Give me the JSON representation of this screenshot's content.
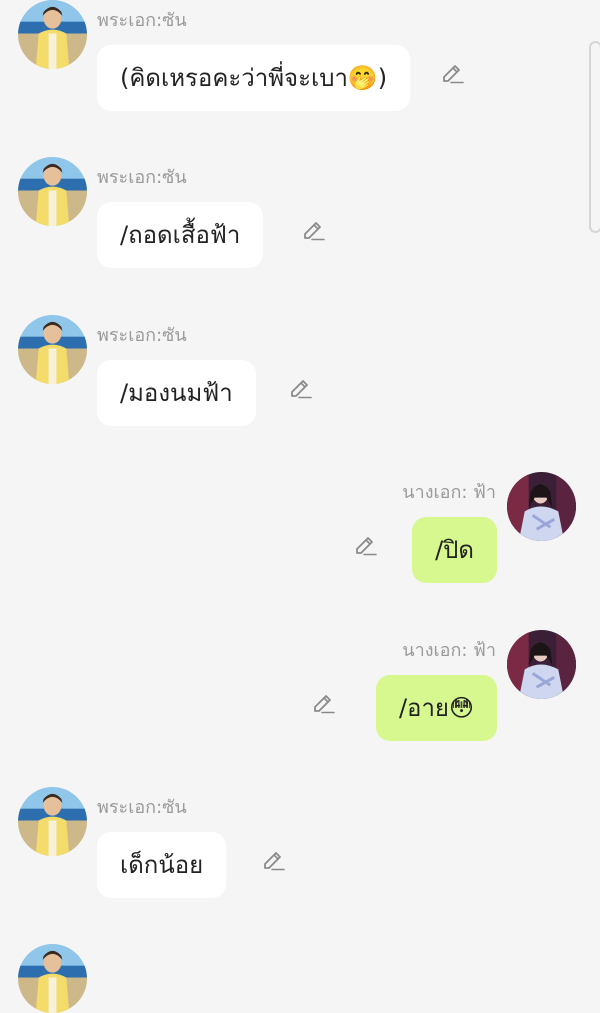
{
  "messages": [
    {
      "side": "left",
      "sender": "พระเอก:ซัน",
      "text": "(คิดเหรอคะว่าพี่จะเบา🤭)",
      "avatar_icon": "hero-avatar-icon",
      "action_icon": "pencil-edit-icon"
    },
    {
      "side": "left",
      "sender": "พระเอก:ซัน",
      "text": "/ถอดเสื้อฟ้า",
      "avatar_icon": "hero-avatar-icon",
      "action_icon": "pencil-edit-icon"
    },
    {
      "side": "left",
      "sender": "พระเอก:ซัน",
      "text": "/มองนมฟ้า",
      "avatar_icon": "hero-avatar-icon",
      "action_icon": "pencil-edit-icon"
    },
    {
      "side": "right",
      "sender": "นางเอก: ฟ้า",
      "text": "/ปิด",
      "avatar_icon": "heroine-avatar-icon",
      "action_icon": "pencil-edit-icon"
    },
    {
      "side": "right",
      "sender": "นางเอก: ฟ้า",
      "text": "/อาย😳",
      "avatar_icon": "heroine-avatar-icon",
      "action_icon": "pencil-edit-icon"
    },
    {
      "side": "left",
      "sender": "พระเอก:ซัน",
      "text": "เด็กน้อย",
      "avatar_icon": "hero-avatar-icon",
      "action_icon": "pencil-edit-icon"
    }
  ],
  "colors": {
    "background": "#f5f5f5",
    "left_bubble": "#ffffff",
    "right_bubble": "#d7f78f",
    "sender_text": "#9a9a9a",
    "message_text": "#222222",
    "edit_icon": "#8a8a8a"
  }
}
